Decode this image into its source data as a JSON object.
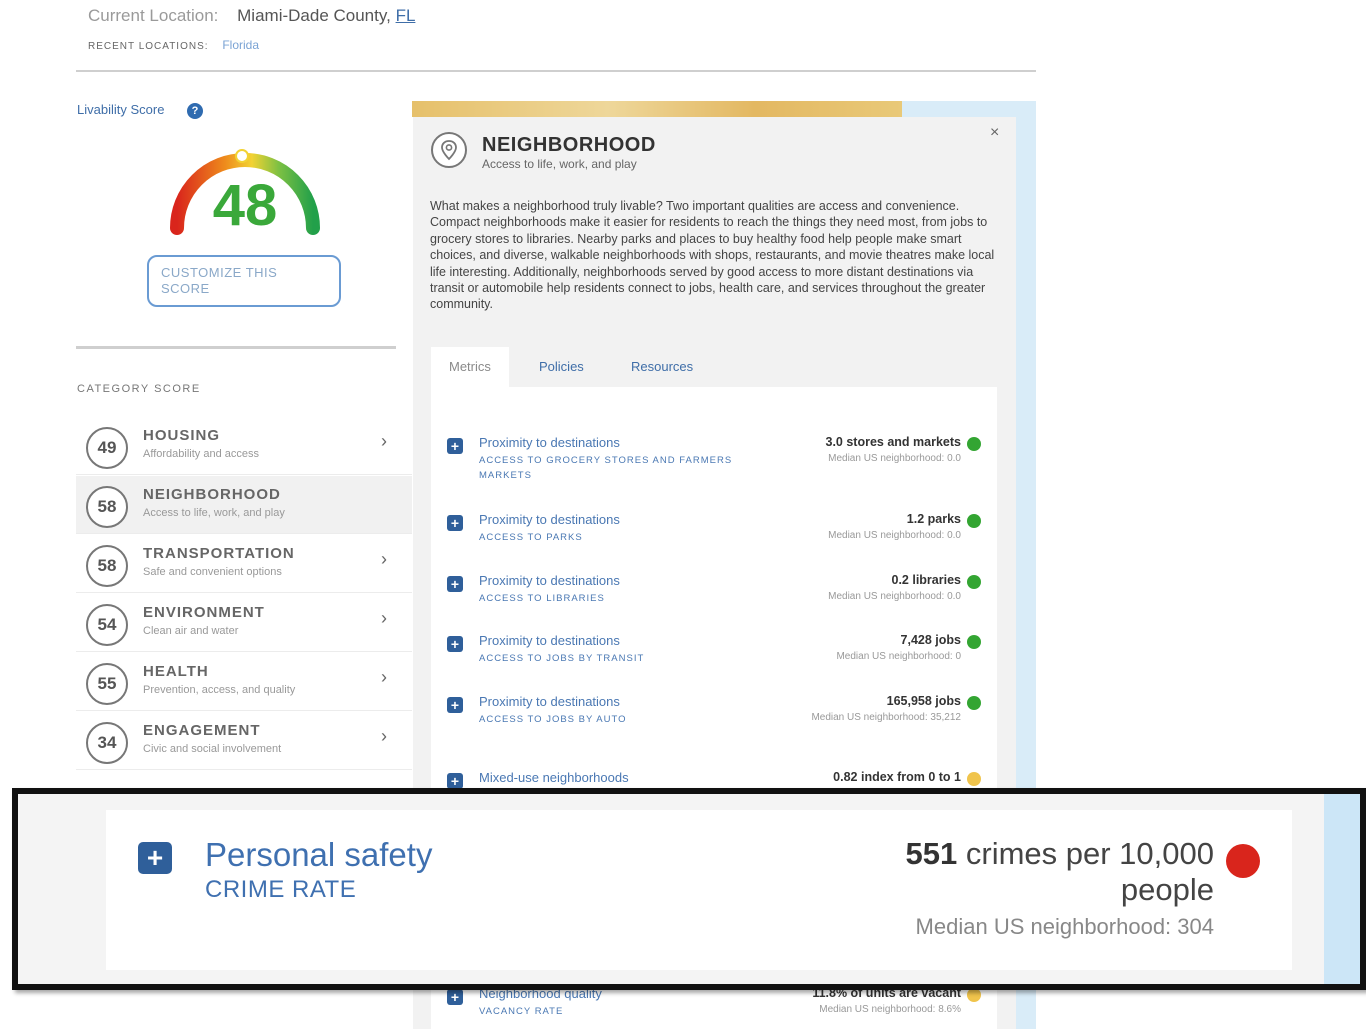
{
  "header": {
    "location_label": "Current Location:",
    "county": "Miami-Dade County,",
    "state": "FL",
    "recent_label": "RECENT LOCATIONS:",
    "recent_item": "Florida"
  },
  "livability": {
    "label": "Livability Score",
    "help_icon": "question-icon",
    "score": "48",
    "customize_button": "CUSTOMIZE THIS SCORE"
  },
  "categories": {
    "header": "CATEGORY SCORE",
    "items": [
      {
        "score": "49",
        "name": "HOUSING",
        "sub": "Affordability and access"
      },
      {
        "score": "58",
        "name": "NEIGHBORHOOD",
        "sub": "Access to life, work, and play"
      },
      {
        "score": "58",
        "name": "TRANSPORTATION",
        "sub": "Safe and convenient options"
      },
      {
        "score": "54",
        "name": "ENVIRONMENT",
        "sub": "Clean air and water"
      },
      {
        "score": "55",
        "name": "HEALTH",
        "sub": "Prevention, access, and quality"
      },
      {
        "score": "34",
        "name": "ENGAGEMENT",
        "sub": "Civic and social involvement"
      }
    ]
  },
  "panel": {
    "title": "NEIGHBORHOOD",
    "subtitle": "Access to life, work, and play",
    "close": "×",
    "description": "What makes a neighborhood truly livable? Two important qualities are access and convenience. Compact neighborhoods make it easier for residents to reach the things they need most, from jobs to grocery stores to libraries. Nearby parks and places to buy healthy food help people make smart choices, and diverse, walkable neighborhoods with shops, restaurants, and movie theatres make local life interesting. Additionally, neighborhoods served by good access to more distant destinations via transit or automobile help residents connect to jobs, health care, and services throughout the greater community.",
    "tabs": [
      "Metrics",
      "Policies",
      "Resources"
    ]
  },
  "metrics": [
    {
      "title": "Proximity to destinations",
      "sub": "ACCESS TO GROCERY STORES AND FARMERS MARKETS",
      "value": "3.0 stores and markets",
      "median": "Median US neighborhood: 0.0",
      "color": "#33a532"
    },
    {
      "title": "Proximity to destinations",
      "sub": "ACCESS TO PARKS",
      "value": "1.2 parks",
      "median": "Median US neighborhood: 0.0",
      "color": "#33a532"
    },
    {
      "title": "Proximity to destinations",
      "sub": "ACCESS TO LIBRARIES",
      "value": "0.2 libraries",
      "median": "Median US neighborhood: 0.0",
      "color": "#33a532"
    },
    {
      "title": "Proximity to destinations",
      "sub": "ACCESS TO JOBS BY TRANSIT",
      "value": "7,428 jobs",
      "median": "Median US neighborhood: 0",
      "color": "#33a532"
    },
    {
      "title": "Proximity to destinations",
      "sub": "ACCESS TO JOBS BY AUTO",
      "value": "165,958 jobs",
      "median": "Median US neighborhood: 35,212",
      "color": "#33a532"
    },
    {
      "title": "Mixed-use neighborhoods",
      "sub": "",
      "value": "0.82 index from 0 to 1",
      "median": "",
      "color": "#f0c44c"
    }
  ],
  "highlight": {
    "title": "Personal safety",
    "sub": "CRIME RATE",
    "value_number": "551",
    "value_unit": "crimes per 10,000 people",
    "median": "Median US neighborhood: 304",
    "color": "#d9251c"
  },
  "bottom_metric": {
    "title": "Neighborhood quality",
    "sub": "VACANCY RATE",
    "value": "11.8% of units are vacant",
    "median": "Median US neighborhood: 8.6%",
    "color": "#f0c44c"
  }
}
